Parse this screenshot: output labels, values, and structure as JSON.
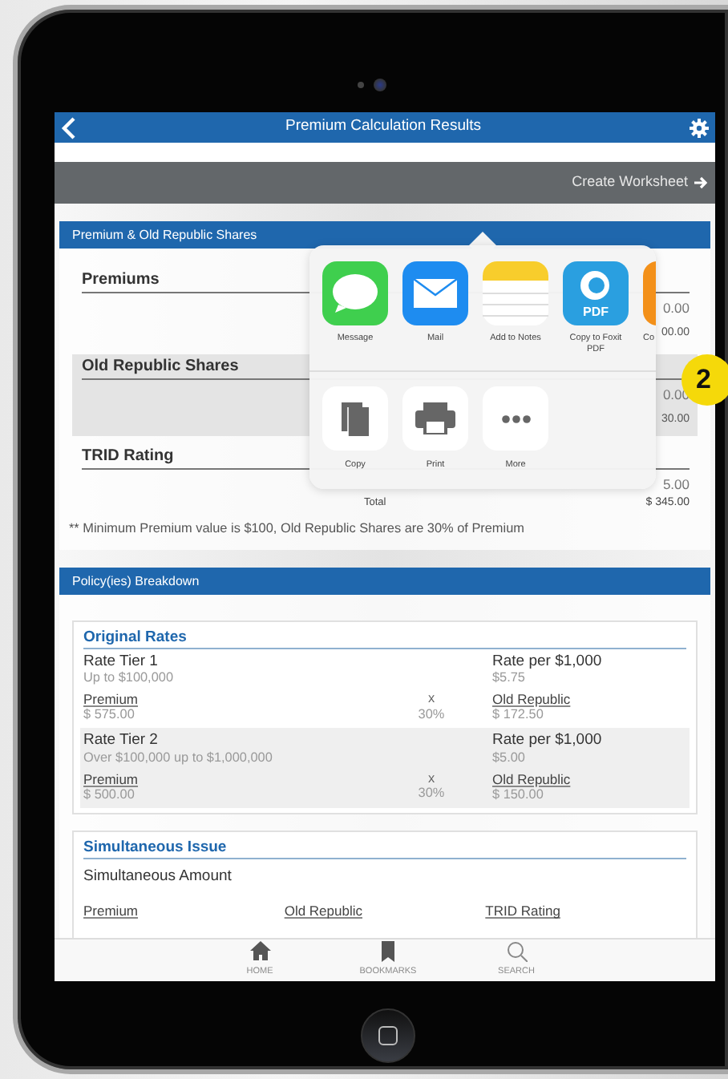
{
  "nav_bar": {
    "title": "Premium Calculation Results"
  },
  "action_bar": {
    "link": "Create Worksheet"
  },
  "shares_card": {
    "header": "Premium & Old Republic Shares",
    "sections": [
      {
        "heading": "Premiums",
        "shaded": false,
        "values": [
          "0.00",
          "00.00"
        ]
      },
      {
        "heading": "Old Republic Shares",
        "shaded": true,
        "values": [
          "0.00",
          "30.00"
        ]
      },
      {
        "heading": "TRID Rating",
        "shaded": false,
        "values": [
          "5.00"
        ]
      }
    ],
    "total": {
      "label": "Total",
      "value": "$ 345.00"
    },
    "footnote": "** Minimum Premium value is $100, Old Republic Shares are 30% of Premium"
  },
  "breakdown_card": {
    "header": "Policy(ies) Breakdown",
    "original_rates": {
      "title": "Original Rates",
      "tiers": [
        {
          "name": "Rate Tier 1",
          "range": "Up to $100,000",
          "rate_label": "Rate per $1,000",
          "rate": "$5.75",
          "premium_label": "Premium",
          "premium": "$ 575.00",
          "operator": "x",
          "share_percent": "30%",
          "share_label": "Old Republic",
          "share_value": "$ 172.50",
          "shaded": false
        },
        {
          "name": "Rate Tier 2",
          "range": "Over $100,000 up to $1,000,000",
          "rate_label": "Rate per $1,000",
          "rate": "$5.00",
          "premium_label": "Premium",
          "premium": "$ 500.00",
          "operator": "x",
          "share_percent": "30%",
          "share_label": "Old Republic",
          "share_value": "$ 150.00",
          "shaded": true
        }
      ]
    },
    "simultaneous_issue": {
      "title": "Simultaneous Issue",
      "subtitle": "Simultaneous Amount",
      "columns": [
        "Premium",
        "Old Republic",
        "TRID Rating"
      ]
    }
  },
  "tab_bar": [
    {
      "label": "HOME",
      "kind": "home"
    },
    {
      "label": "BOOKMARKS",
      "kind": "bookmark"
    },
    {
      "label": "SEARCH",
      "kind": "search"
    }
  ],
  "share_sheet": {
    "apps": [
      {
        "label": "Message",
        "kind": "message"
      },
      {
        "label": "Mail",
        "kind": "mail"
      },
      {
        "label": "Add to Notes",
        "kind": "notes"
      },
      {
        "label": "Copy to Foxit PDF",
        "kind": "pdf",
        "icon_text": "PDF"
      },
      {
        "label": "Co",
        "kind": "partial"
      }
    ],
    "actions": [
      {
        "label": "Copy",
        "kind": "copy"
      },
      {
        "label": "Print",
        "kind": "print"
      },
      {
        "label": "More",
        "kind": "more"
      }
    ]
  },
  "callout": {
    "number": "2"
  }
}
